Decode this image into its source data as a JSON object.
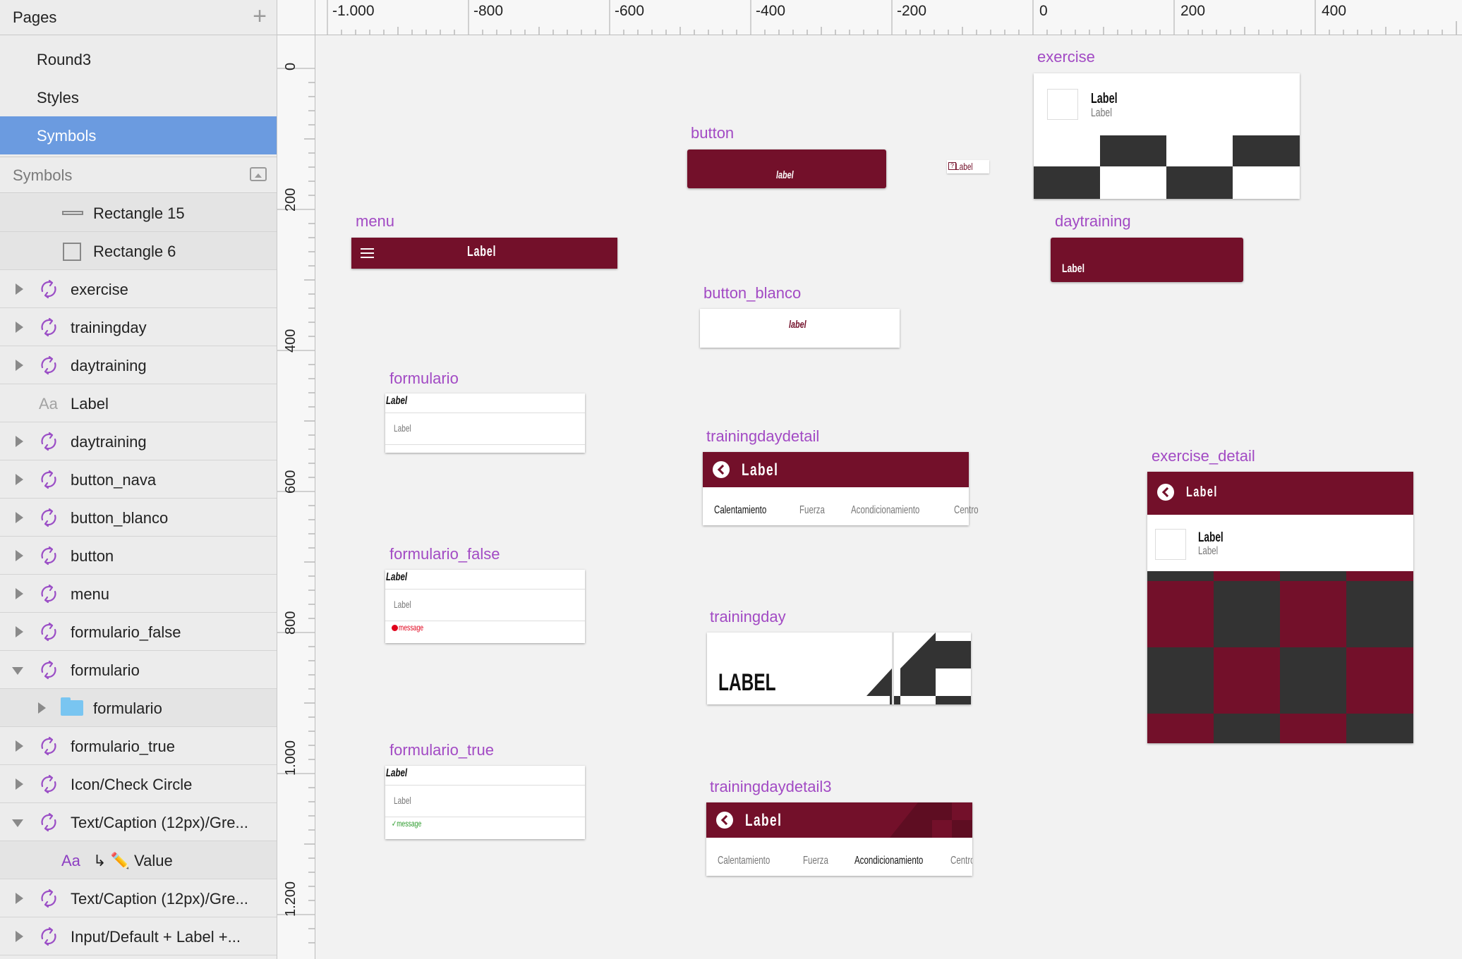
{
  "sidebar": {
    "pages_header": "Pages",
    "pages": [
      {
        "label": "Round3"
      },
      {
        "label": "Styles"
      },
      {
        "label": "Symbols",
        "selected": true
      }
    ],
    "symbols_header": "Symbols",
    "layers": [
      {
        "label": "Rectangle 15",
        "icon": "rectangle-line-icon"
      },
      {
        "label": "Rectangle 6",
        "icon": "rectangle-icon"
      },
      {
        "label": "exercise",
        "icon": "symbol-icon"
      },
      {
        "label": "trainingday",
        "icon": "symbol-icon"
      },
      {
        "label": "daytraining",
        "icon": "symbol-icon"
      },
      {
        "label": "Label",
        "icon": "text-icon",
        "icon_text": "Aa"
      },
      {
        "label": "daytraining",
        "icon": "symbol-icon"
      },
      {
        "label": "button_nava",
        "icon": "symbol-icon"
      },
      {
        "label": "button_blanco",
        "icon": "symbol-icon"
      },
      {
        "label": "button",
        "icon": "symbol-icon"
      },
      {
        "label": "menu",
        "icon": "symbol-icon"
      },
      {
        "label": "formulario_false",
        "icon": "symbol-icon"
      },
      {
        "label": "formulario",
        "icon": "symbol-icon"
      },
      {
        "label": "formulario",
        "icon": "folder-icon"
      },
      {
        "label": "formulario_true",
        "icon": "symbol-icon"
      },
      {
        "label": "Icon/Check Circle",
        "icon": "symbol-icon"
      },
      {
        "label": "Text/Caption (12px)/Gre...",
        "icon": "symbol-icon"
      },
      {
        "label": "↳ ✏️ Value",
        "icon": "text-icon",
        "icon_text": "Aa"
      },
      {
        "label": "Text/Caption (12px)/Gre...",
        "icon": "symbol-icon"
      },
      {
        "label": "Input/Default + Label +...",
        "icon": "symbol-icon"
      }
    ]
  },
  "ruler": {
    "h_labels": [
      "-1.000",
      "-800",
      "-600",
      "-400",
      "-200",
      "0",
      "200",
      "400"
    ],
    "v_labels": [
      "0",
      "200",
      "400",
      "600",
      "800",
      "1.000",
      "1.200"
    ]
  },
  "artboards": {
    "exercise": {
      "name": "exercise",
      "title": "Label",
      "subtitle": "Label"
    },
    "button": {
      "name": "button",
      "text": "label"
    },
    "small_label": {
      "text": "Label"
    },
    "menu": {
      "name": "menu",
      "text": "Label"
    },
    "daytraining": {
      "name": "daytraining",
      "text": "Label"
    },
    "button_blanco": {
      "name": "button_blanco",
      "text": "label"
    },
    "formulario": {
      "name": "formulario",
      "label": "Label",
      "input": "Label"
    },
    "formulario_false": {
      "name": "formulario_false",
      "label": "Label",
      "input": "Label",
      "message": "message"
    },
    "formulario_true": {
      "name": "formulario_true",
      "label": "Label",
      "input": "Label",
      "message": "✓message"
    },
    "trainingdaydetail": {
      "name": "trainingdaydetail",
      "title": "Label",
      "tabs": [
        "Calentamiento",
        "Fuerza",
        "Acondicionamiento",
        "Centro"
      ],
      "active_tab": 0
    },
    "exercise_detail": {
      "name": "exercise_detail",
      "title": "Label",
      "item_title": "Label",
      "item_subtitle": "Label"
    },
    "trainingday": {
      "name": "trainingday",
      "text": "LABEL"
    },
    "trainingdaydetail3": {
      "name": "trainingdaydetail3",
      "title": "Label",
      "tabs": [
        "Calentamiento",
        "Fuerza",
        "Acondicionamiento",
        "Centro"
      ],
      "active_tab": 2
    }
  },
  "colors": {
    "accent": "#73102a",
    "selection": "#6b9be0",
    "artboard_label": "#a24ac4",
    "error": "#e0001a",
    "success": "#2a9a2a",
    "dark_checker": "#333333"
  }
}
